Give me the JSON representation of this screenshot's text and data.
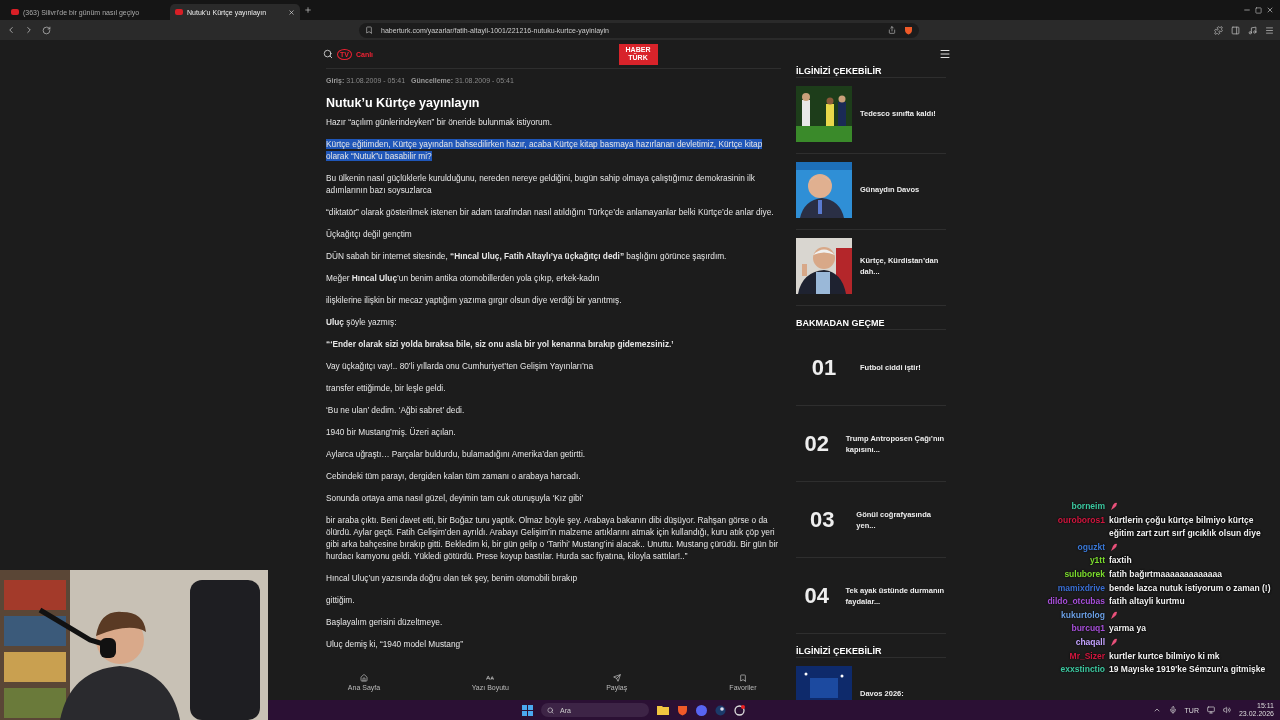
{
  "browser": {
    "tabs": [
      {
        "title": "(363) Silivri'de bir günüm nasıl geçiyo",
        "selected": false
      },
      {
        "title": "Nutuk'u Kürtçe yayınlayın",
        "selected": true
      }
    ],
    "url": "haberturk.com/yazarlar/fatih-altayli-1001/221216-nutuku-kurtce-yayinlayin"
  },
  "site_header": {
    "tv_badge": "TV",
    "live_label": "Canlı",
    "logo_lines": [
      "HABER",
      "TÜRK"
    ]
  },
  "article": {
    "meta": [
      {
        "label": "Giriş:",
        "value": "31.08.2009 - 05:41"
      },
      {
        "label": "Güncelleme:",
        "value": "31.08.2009 - 05:41"
      }
    ],
    "title": "Nutuk’u Kürtçe yayınlayın",
    "paragraphs": [
      {
        "text": "Hazır “açılım günlerindeyken” bir öneride bulunmak istiyorum.",
        "bold": false,
        "selected": false
      },
      {
        "text": "Kürtçe eğitimden, Kürtçe yayından bahsedilirken hazır, acaba Kürtçe kitap basmaya hazırlanan devletimiz, Kürtçe kitap olarak “Nutuk”u basabilir mi?",
        "bold": false,
        "selected": true
      },
      {
        "text": "Bu ülkenin nasıl güçlüklerle kurulduğunu, nereden nereye geldiğini, bugün sahip olmaya çalıştığımız demokrasinin ilk adımlarının bazı soysuzlarca",
        "bold": false,
        "selected": false
      },
      {
        "text": "“diktatör” olarak gösterilmek istenen bir adam tarafından nasıl atıldığını Türkçe’de anlamayanlar belki Kürtçe’de anlar diye.",
        "bold": false,
        "selected": false
      },
      {
        "text": "Üçkağıtçı değil gençtim",
        "bold": false,
        "selected": false
      },
      {
        "text": "DÜN sabah bir internet sitesinde, **“Hıncal Uluç, Fatih Altaylı’ya üçkağıtçı dedi”** başlığını görünce şaşırdım.",
        "bold": false,
        "selected": false
      },
      {
        "text": "Meğer **Hıncal Uluç**’un benim antika otomobillerden yola çıkıp, erkek-kadın",
        "bold": false,
        "selected": false
      },
      {
        "text": "ilişkilerine ilişkin bir mecaz yaptığım yazıma gırgır olsun diye verdiği bir yanıtmış.",
        "bold": false,
        "selected": false
      },
      {
        "text": "**Uluç** şöyle yazmış:",
        "bold": false,
        "selected": false
      },
      {
        "text": "“‘Ender olarak sizi yolda bıraksa bile, siz onu asla bir yol kenarına bırakıp gidemezsiniz.’",
        "bold": true,
        "selected": false
      },
      {
        "text": "Vay üçkağıtçı vay!.. 80’li yıllarda onu Cumhuriyet’ten Gelişim Yayınları’na",
        "bold": false,
        "selected": false
      },
      {
        "text": "transfer ettiğimde, bir leşle geldi.",
        "bold": false,
        "selected": false
      },
      {
        "text": "‘Bu ne ulan’ dedim. ‘Ağbi sabret’ dedi.",
        "bold": false,
        "selected": false
      },
      {
        "text": "1940 bir Mustang’miş. Üzeri açılan.",
        "bold": false,
        "selected": false
      },
      {
        "text": "Aylarca uğraştı… Parçalar buldurdu, bulamadığını Amerika’dan getirtti.",
        "bold": false,
        "selected": false
      },
      {
        "text": "Cebindeki tüm parayı, dergiden kalan tüm zamanı o arabaya harcadı.",
        "bold": false,
        "selected": false
      },
      {
        "text": "Sonunda ortaya ama nasıl güzel, deyimin tam cuk oturuşuyla ‘Kız gibi’",
        "bold": false,
        "selected": false
      },
      {
        "text": "bir araba çıktı. Beni davet etti, bir Boğaz turu yaptık. Olmaz böyle şey. Arabaya bakanın dibi düşüyor. Rahşan görse o da ölürdü. Aylar geçti. Fatih Gelişim’den ayrıldı. Arabayı Gelişim’in malzeme artıklarını atmak için kullandığı, kuru atık çöp yeri gibi arka bahçesine bırakıp gitti. Bekledim ki, bir gün gelip o ‘Tarihi’ Mustang’ini alacak.. Unuttu. Mustang çürüdü. Bir gün bir hurdacı kamyonu geldi. Yükledi götürdü. Prese koyup bastılar. Hurda sac fiyatına, kiloyla sattılar!..”",
        "bold": false,
        "selected": false
      },
      {
        "text": "Hıncal Uluç’un yazısında doğru olan tek şey, benim otomobili bırakıp",
        "bold": false,
        "selected": false
      },
      {
        "text": "gittiğim.",
        "bold": false,
        "selected": false
      },
      {
        "text": "Başlayalım gerisini düzeltmeye.",
        "bold": false,
        "selected": false
      },
      {
        "text": "Uluç demiş ki, “1940 model Mustang”",
        "bold": false,
        "selected": false
      }
    ]
  },
  "sidebar": [
    {
      "title": "İLGİNİZİ ÇEKEBİLİR",
      "kind": "picture",
      "items": [
        {
          "title": "Tedesco sınıfta kaldı!"
        },
        {
          "title": "Günaydın Davos"
        },
        {
          "title": "Kürtçe, Kürdistan’dan dah..."
        }
      ]
    },
    {
      "title": "BAKMADAN GEÇME",
      "kind": "numbered",
      "items": [
        {
          "number": "01",
          "title": "Futbol ciddi iştir!"
        },
        {
          "number": "02",
          "title": "Trump Antroposen Çağı’nın kapısını..."
        },
        {
          "number": "03",
          "title": "Gönül coğrafyasında yen..."
        },
        {
          "number": "04",
          "title": "Tek ayak üstünde durmanın faydalar..."
        }
      ]
    },
    {
      "title": "İLGİNİZİ ÇEKEBİLİR",
      "kind": "picture",
      "items": [
        {
          "title": "Davos 2026:"
        }
      ]
    }
  ],
  "bottom_nav": [
    {
      "label": "Ana Sayfa"
    },
    {
      "label": "Yazı Boyutu"
    },
    {
      "label": "Paylaş"
    },
    {
      "label": "Favoriler"
    }
  ],
  "chat": [
    {
      "user": "borneim",
      "color": "#3cc8a0",
      "kind": "emote"
    },
    {
      "user": "ouroboros1",
      "color": "#d0163e",
      "kind": "text",
      "message": "kürtlerin çoğu kürtçe bilmiyo kürtçe eğitim zart zurt sırf gıcıklık olsun diye"
    },
    {
      "user": "oguzkt",
      "color": "#3a78d6",
      "kind": "emote"
    },
    {
      "user": "y1tt",
      "color": "#7cdc2e",
      "kind": "text",
      "message": "faxtih"
    },
    {
      "user": "suluborek",
      "color": "#7cdc2e",
      "kind": "text",
      "message": "fatih bağırtmaaaaaaaaaaaaa"
    },
    {
      "user": "mamixdrive",
      "color": "#3a6fd4",
      "kind": "text",
      "message": "bende lazca nutuk istiyorum o zaman (!)"
    },
    {
      "user": "dildo_otcubas",
      "color": "#a64fd8",
      "kind": "text",
      "message": "fatih altayli kurtmu"
    },
    {
      "user": "kukurtolog",
      "color": "#6b9fe4",
      "kind": "emote"
    },
    {
      "user": "burcuq1",
      "color": "#a64fd8",
      "kind": "text",
      "message": "yarma ya"
    },
    {
      "user": "chaqall",
      "color": "#c4a4ff",
      "kind": "emote"
    },
    {
      "user": "Mr_Sizer",
      "color": "#d0163e",
      "kind": "text",
      "message": "kurtler kurtce bilmiyo ki mk"
    },
    {
      "user": "exxstinctio",
      "color": "#3cc8a0",
      "kind": "text",
      "message": "19 Mayıske 1919'ke Sémzun'a gitmişke"
    }
  ],
  "taskbar": {
    "search_placeholder": "Ara",
    "language": "TUR",
    "time": "15:11",
    "date": "23.02.2026"
  }
}
